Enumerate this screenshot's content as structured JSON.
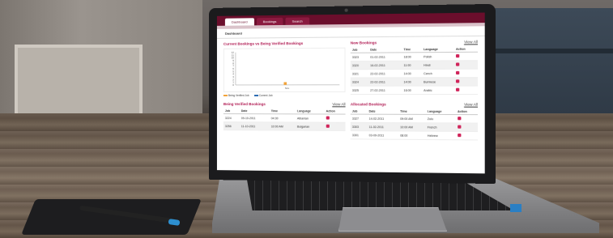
{
  "app": {
    "tabs": [
      "Dashboard",
      "Bookings",
      "Search"
    ],
    "active_tab": "Dashboard",
    "breadcrumb": "Dashboard"
  },
  "chart_panel": {
    "title": "Current Bookings vs Being Verified Bookings",
    "legend": [
      "Being Verified Job",
      "Current Job"
    ],
    "colors": {
      "verified": "#f2a33a",
      "current": "#2e6db4"
    }
  },
  "chart_data": {
    "type": "bar",
    "categories": [
      "Nov"
    ],
    "series": [
      {
        "name": "Being Verified Job",
        "values": [
          1
        ]
      },
      {
        "name": "Current Job",
        "values": [
          0
        ]
      }
    ],
    "ylim": [
      0,
      12
    ],
    "yticks": [
      "12",
      "11",
      "10",
      "9",
      "8",
      "7",
      "6",
      "5",
      "4",
      "3",
      "2",
      "1",
      "0"
    ]
  },
  "new_bookings": {
    "title": "New Bookings",
    "view_all": "View All",
    "columns": [
      "Job",
      "Date",
      "Time",
      "Language",
      "Action"
    ],
    "rows": [
      [
        "3323",
        "01-02-2011",
        "18:00",
        "Polish"
      ],
      [
        "3320",
        "16-02-2011",
        "11:00",
        "Hindi"
      ],
      [
        "3321",
        "22-02-2011",
        "14:00",
        "Czech"
      ],
      [
        "3324",
        "22-02-2011",
        "14:00",
        "Burmese"
      ],
      [
        "3325",
        "27-02-2011",
        "16:00",
        "Arabic"
      ]
    ]
  },
  "being_verified": {
    "title": "Being Verified Bookings",
    "view_all": "View All",
    "columns": [
      "Job",
      "Date",
      "Time",
      "Language",
      "Action"
    ],
    "rows": [
      [
        "3224",
        "09-10-2011",
        "04:30",
        "Albanian"
      ],
      [
        "3256",
        "11-10-2011",
        "10:00 AM",
        "Bulgarian"
      ]
    ]
  },
  "allocated": {
    "title": "Allocated Bookings",
    "view_all": "View All",
    "columns": [
      "Job",
      "Date",
      "Time",
      "Language",
      "Action"
    ],
    "rows": [
      [
        "3327",
        "14-02-2011",
        "09:00 AM",
        "Zulu"
      ],
      [
        "3303",
        "11-02-2011",
        "10:00 AM",
        "French"
      ],
      [
        "3301",
        "03-09-2011",
        "08:00",
        "Hebrew"
      ]
    ]
  }
}
